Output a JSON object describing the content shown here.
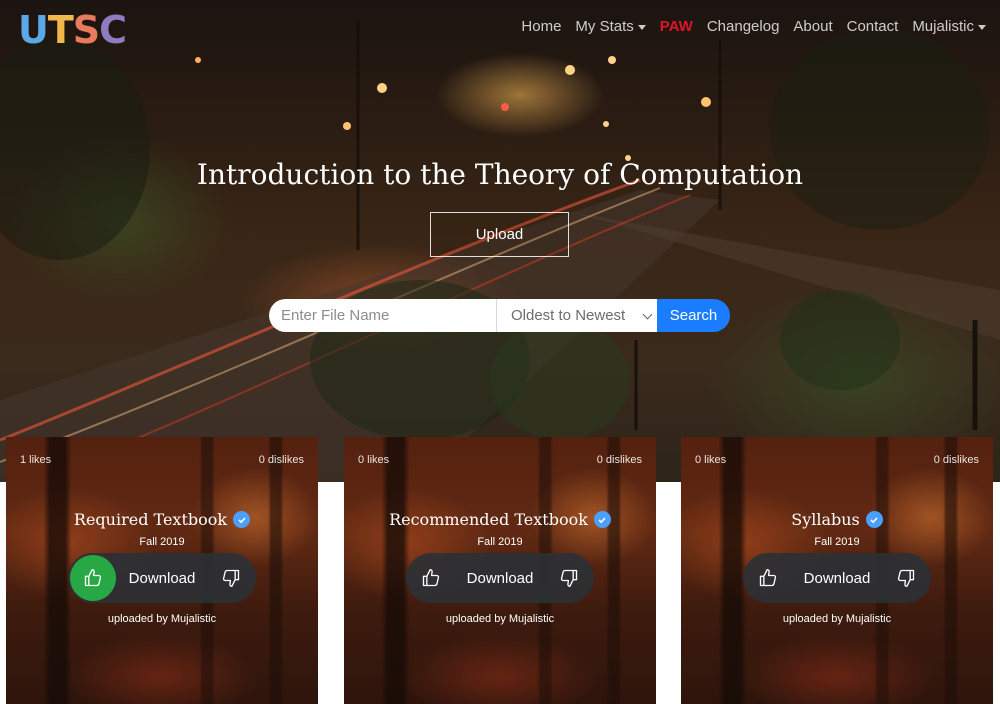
{
  "brand": {
    "logo_letters": [
      "U",
      "T",
      "S",
      "C"
    ],
    "logo_colors": [
      "#5aa9e6",
      "#f2b84b",
      "#e87a5d",
      "#8e7cc3"
    ]
  },
  "nav": {
    "items": [
      {
        "label": "Home",
        "dropdown": false,
        "color": ""
      },
      {
        "label": "My Stats",
        "dropdown": true,
        "color": ""
      },
      {
        "label": "PAW",
        "dropdown": false,
        "color": "#e0152b"
      },
      {
        "label": "Changelog",
        "dropdown": false,
        "color": ""
      },
      {
        "label": "About",
        "dropdown": false,
        "color": ""
      },
      {
        "label": "Contact",
        "dropdown": false,
        "color": ""
      },
      {
        "label": "Mujalistic",
        "dropdown": true,
        "color": ""
      }
    ]
  },
  "hero": {
    "title": "Introduction to the Theory of Computation",
    "upload_label": "Upload"
  },
  "search": {
    "placeholder": "Enter File Name",
    "sort_selected": "Oldest to Newest",
    "button_label": "Search",
    "button_color": "#1a7dff"
  },
  "cards": [
    {
      "likes": "1 likes",
      "dislikes": "0 dislikes",
      "title": "Required Textbook",
      "term": "Fall 2019",
      "download_label": "Download",
      "uploader": "uploaded by Mujalistic",
      "liked": true
    },
    {
      "likes": "0 likes",
      "dislikes": "0 dislikes",
      "title": "Recommended Textbook",
      "term": "Fall 2019",
      "download_label": "Download",
      "uploader": "uploaded by Mujalistic",
      "liked": false
    },
    {
      "likes": "0 likes",
      "dislikes": "0 dislikes",
      "title": "Syllabus",
      "term": "Fall 2019",
      "download_label": "Download",
      "uploader": "uploaded by Mujalistic",
      "liked": false
    }
  ],
  "icons": {
    "like": "thumbs-up-icon",
    "dislike": "thumbs-down-icon",
    "verified": "verified-check-icon",
    "dropdown": "caret-down-icon",
    "select": "chevron-down-icon"
  },
  "colors": {
    "like_active": "#27a844",
    "verified": "#4a9fff"
  }
}
